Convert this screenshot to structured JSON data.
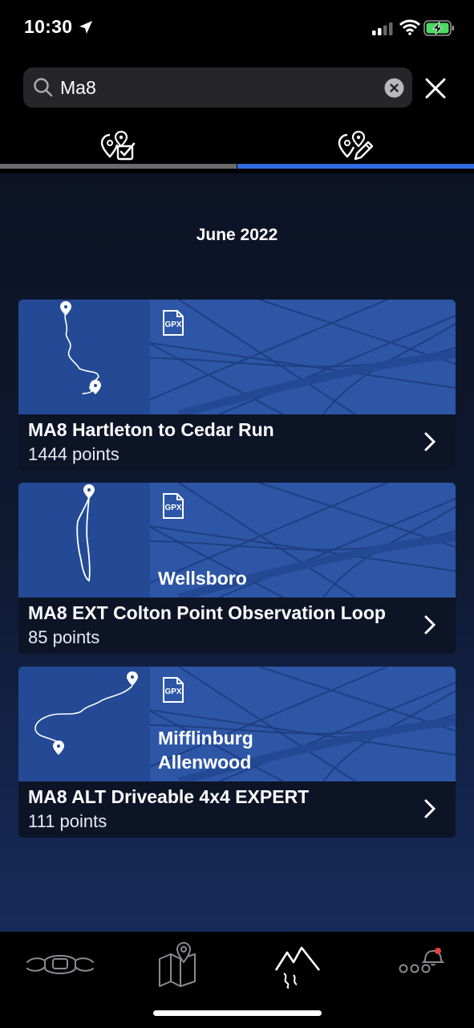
{
  "status_bar": {
    "time": "10:30"
  },
  "search": {
    "query": "Ma8"
  },
  "tabs": [
    {
      "name": "saved-routes",
      "active": false
    },
    {
      "name": "created-routes",
      "active": true
    }
  ],
  "section": {
    "title": "June 2022"
  },
  "routes": [
    {
      "name": "MA8 Hartleton to Cedar Run",
      "points": "1444 points",
      "file_type": "GPX",
      "regions": []
    },
    {
      "name": "MA8 EXT Colton Point Observation Loop",
      "points": "85 points",
      "file_type": "GPX",
      "regions": [
        "Wellsboro"
      ]
    },
    {
      "name": "MA8 ALT Driveable 4x4 EXPERT",
      "points": "111 points",
      "file_type": "GPX",
      "regions": [
        "Mifflinburg",
        "Allenwood"
      ]
    }
  ],
  "colors": {
    "accent": "#2f6be3",
    "card_banner": "#2d56a7",
    "card_footer": "#0c1426"
  },
  "nav": [
    {
      "icon": "motorcycle-icon"
    },
    {
      "icon": "map-icon"
    },
    {
      "icon": "mountain-trail-icon",
      "active": true
    },
    {
      "icon": "more-notifications-icon"
    }
  ]
}
